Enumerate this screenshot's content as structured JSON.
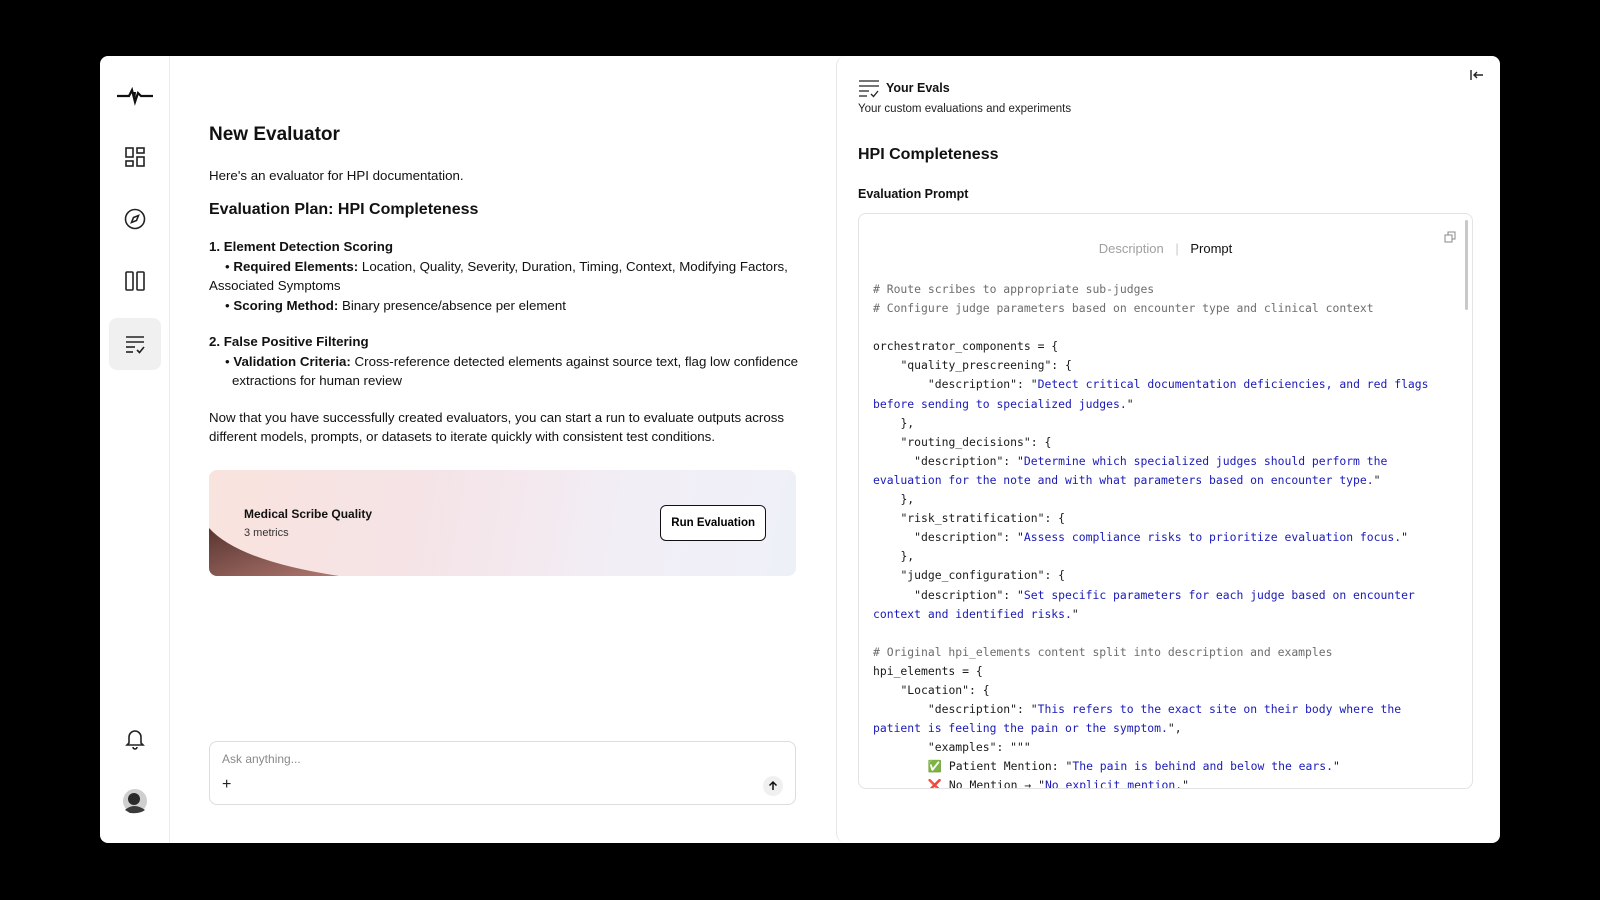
{
  "sidebar": {
    "items": [
      {
        "name": "logo"
      },
      {
        "name": "dashboard"
      },
      {
        "name": "explore"
      },
      {
        "name": "columns"
      },
      {
        "name": "evals"
      }
    ]
  },
  "chat": {
    "title": "New Evaluator",
    "intro": "Here's an evaluator for HPI documentation.",
    "plan_title": "Evaluation Plan: HPI Completeness",
    "sections": [
      {
        "title": "1. Element Detection Scoring",
        "bullets": [
          {
            "label": "Required Elements:",
            "text": " Location, Quality, Severity, Duration, Timing, Context, Modifying Factors,",
            "wrap": "Associated Symptoms"
          },
          {
            "label": "Scoring Method:",
            "text": " Binary presence/absence per element"
          }
        ]
      },
      {
        "title": "2. False Positive Filtering",
        "bullets": [
          {
            "label": "Validation Criteria:",
            "text": " Cross-reference detected elements against source text, flag low confidence extractions for human review"
          }
        ]
      }
    ],
    "closing": "Now that you have successfully created evaluators, you can start a run to evaluate outputs across different models, prompts, or datasets to iterate quickly with consistent test conditions."
  },
  "card": {
    "title": "Medical Scribe Quality",
    "subtitle": "3 metrics",
    "button": "Run Evaluation"
  },
  "ask": {
    "placeholder": "Ask anything...",
    "plus": "+"
  },
  "panel": {
    "title": "Your Evals",
    "subtitle": "Your custom evaluations and experiments",
    "eval_title": "HPI Completeness",
    "prompt_label": "Evaluation Prompt",
    "tabs": {
      "description": "Description",
      "separator": "|",
      "prompt": "Prompt"
    },
    "code": [
      {
        "p": [
          {
            "c": "cmt",
            "t": "# Route scribes to appropriate sub-judges"
          }
        ]
      },
      {
        "p": [
          {
            "c": "cmt",
            "t": "# Configure judge parameters based on encounter type and clinical context"
          }
        ]
      },
      {
        "p": [
          {
            "c": "",
            "t": ""
          }
        ]
      },
      {
        "p": [
          {
            "c": "",
            "t": "orchestrator_components = {"
          }
        ]
      },
      {
        "p": [
          {
            "c": "",
            "t": "    \"quality_prescreening\": {"
          }
        ]
      },
      {
        "p": [
          {
            "c": "",
            "t": "        \"description\": \""
          },
          {
            "c": "str",
            "t": "Detect critical documentation deficiencies, and red flags before sending to specialized judges."
          },
          {
            "c": "",
            "t": "\""
          }
        ]
      },
      {
        "p": [
          {
            "c": "",
            "t": "    },"
          }
        ]
      },
      {
        "p": [
          {
            "c": "",
            "t": "    \"routing_decisions\": {"
          }
        ]
      },
      {
        "p": [
          {
            "c": "",
            "t": "      \"description\": \""
          },
          {
            "c": "str",
            "t": "Determine which specialized judges should perform the evaluation for the note and with what parameters based on encounter type."
          },
          {
            "c": "",
            "t": "\""
          }
        ]
      },
      {
        "p": [
          {
            "c": "",
            "t": "    },"
          }
        ]
      },
      {
        "p": [
          {
            "c": "",
            "t": "    \"risk_stratification\": {"
          }
        ]
      },
      {
        "p": [
          {
            "c": "",
            "t": "      \"description\": \""
          },
          {
            "c": "str",
            "t": "Assess compliance risks to prioritize evaluation focus."
          },
          {
            "c": "",
            "t": "\""
          }
        ]
      },
      {
        "p": [
          {
            "c": "",
            "t": "    },"
          }
        ]
      },
      {
        "p": [
          {
            "c": "",
            "t": "    \"judge_configuration\": {"
          }
        ]
      },
      {
        "p": [
          {
            "c": "",
            "t": "      \"description\": \""
          },
          {
            "c": "str",
            "t": "Set specific parameters for each judge based on encounter context and identified risks."
          },
          {
            "c": "",
            "t": "\""
          }
        ]
      },
      {
        "p": [
          {
            "c": "",
            "t": ""
          }
        ]
      },
      {
        "p": [
          {
            "c": "cmt",
            "t": "# Original hpi_elements content split into description and examples"
          }
        ]
      },
      {
        "p": [
          {
            "c": "",
            "t": "hpi_elements = {"
          }
        ]
      },
      {
        "p": [
          {
            "c": "",
            "t": "    \"Location\": {"
          }
        ]
      },
      {
        "p": [
          {
            "c": "",
            "t": "        \"description\": \""
          },
          {
            "c": "str",
            "t": "This refers to the exact site on their body where the patient is feeling the pain or the symptom."
          },
          {
            "c": "",
            "t": "\","
          }
        ]
      },
      {
        "p": [
          {
            "c": "",
            "t": "        \"examples\": \"\"\""
          }
        ]
      },
      {
        "p": [
          {
            "c": "",
            "t": "        "
          },
          {
            "c": "ok",
            "t": "✅"
          },
          {
            "c": "",
            "t": " Patient Mention: \""
          },
          {
            "c": "str",
            "t": "The pain is behind and below the ears."
          },
          {
            "c": "",
            "t": "\""
          }
        ]
      },
      {
        "p": [
          {
            "c": "",
            "t": "        "
          },
          {
            "c": "bad",
            "t": "❌"
          },
          {
            "c": "",
            "t": " No Mention → \""
          },
          {
            "c": "str",
            "t": "No explicit mention."
          },
          {
            "c": "",
            "t": "\""
          }
        ]
      }
    ]
  },
  "colors": {
    "code_string": "#1a1ab8",
    "code_comment": "#6d6d6d",
    "active_nav_bg": "#f0f0f0"
  }
}
